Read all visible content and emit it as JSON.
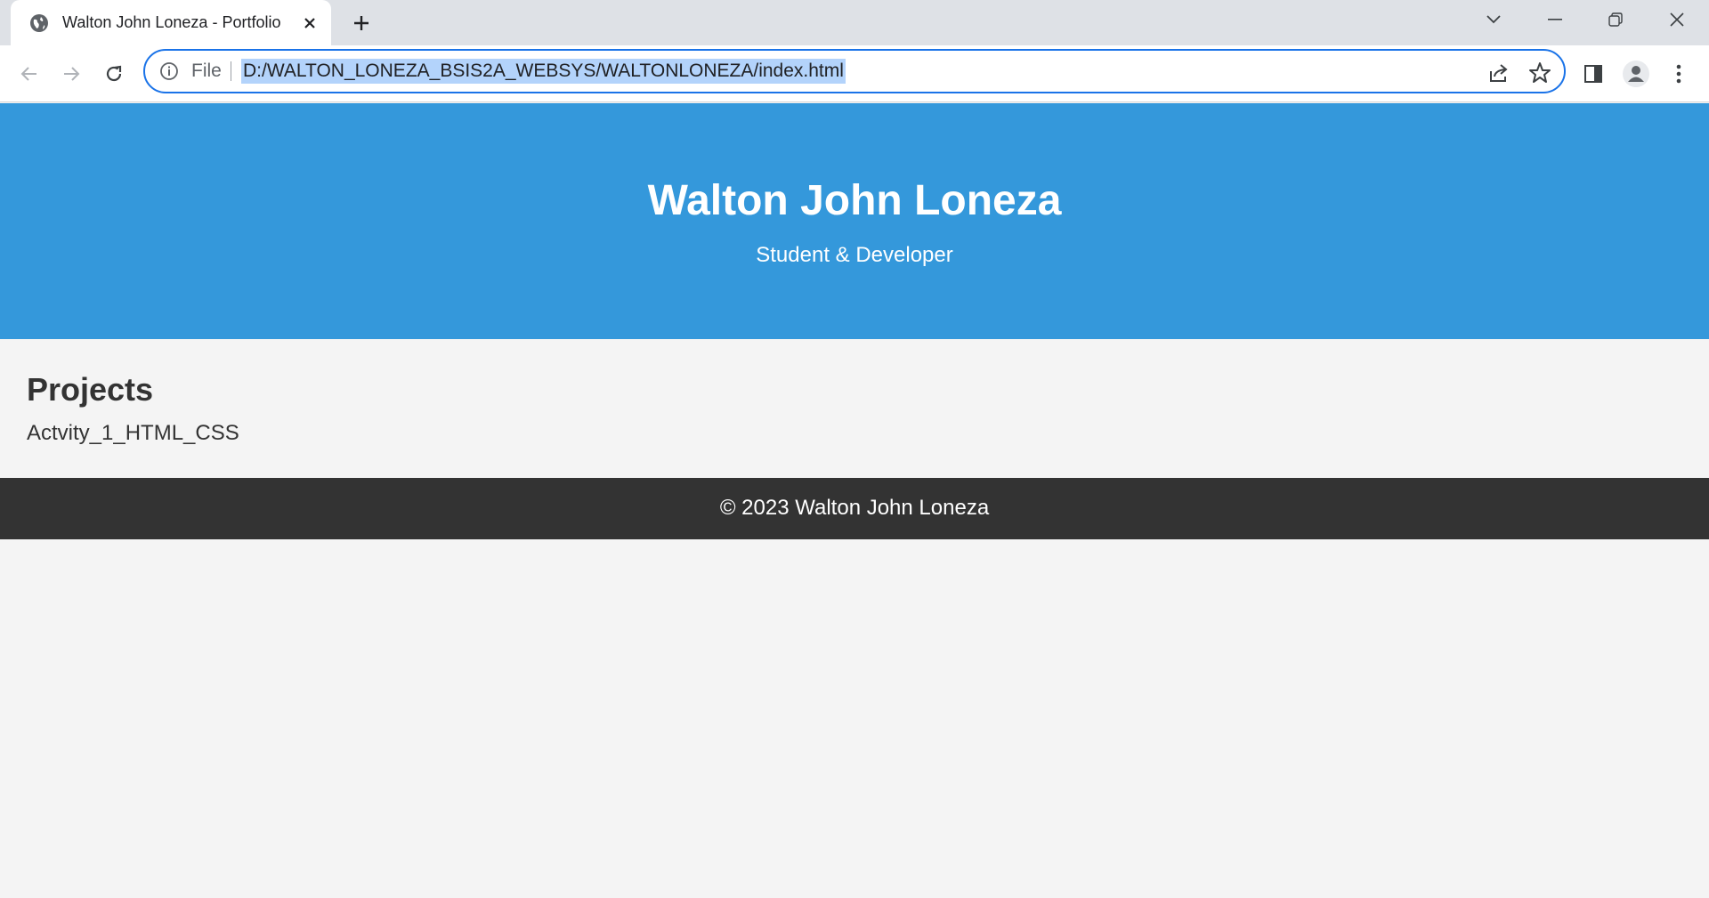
{
  "browser": {
    "tab_title": "Walton John Loneza - Portfolio",
    "omnibox": {
      "scheme_label": "File",
      "url": "D:/WALTON_LONEZA_BSIS2A_WEBSYS/WALTONLONEZA/index.html"
    },
    "icons": {
      "favicon": "globe-icon",
      "tab_close": "close-icon",
      "new_tab": "plus-icon",
      "back": "arrow-left-icon",
      "forward": "arrow-right-icon",
      "reload": "reload-icon",
      "info": "info-icon",
      "share": "share-icon",
      "bookmark": "star-icon",
      "side_panel": "side-panel-icon",
      "profile": "profile-icon",
      "menu": "kebab-menu-icon",
      "tab_search": "chevron-down-icon",
      "minimize": "minimize-icon",
      "restore": "restore-icon",
      "close_window": "close-icon"
    }
  },
  "page": {
    "header": {
      "name": "Walton John Loneza",
      "subtitle": "Student & Developer"
    },
    "projects": {
      "heading": "Projects",
      "items": [
        "Actvity_1_HTML_CSS"
      ]
    },
    "footer": {
      "text": "© 2023 Walton John Loneza"
    }
  },
  "colors": {
    "header_bg": "#3498db",
    "footer_bg": "#333333",
    "page_bg": "#f4f4f4",
    "accent": "#1a73e8"
  }
}
